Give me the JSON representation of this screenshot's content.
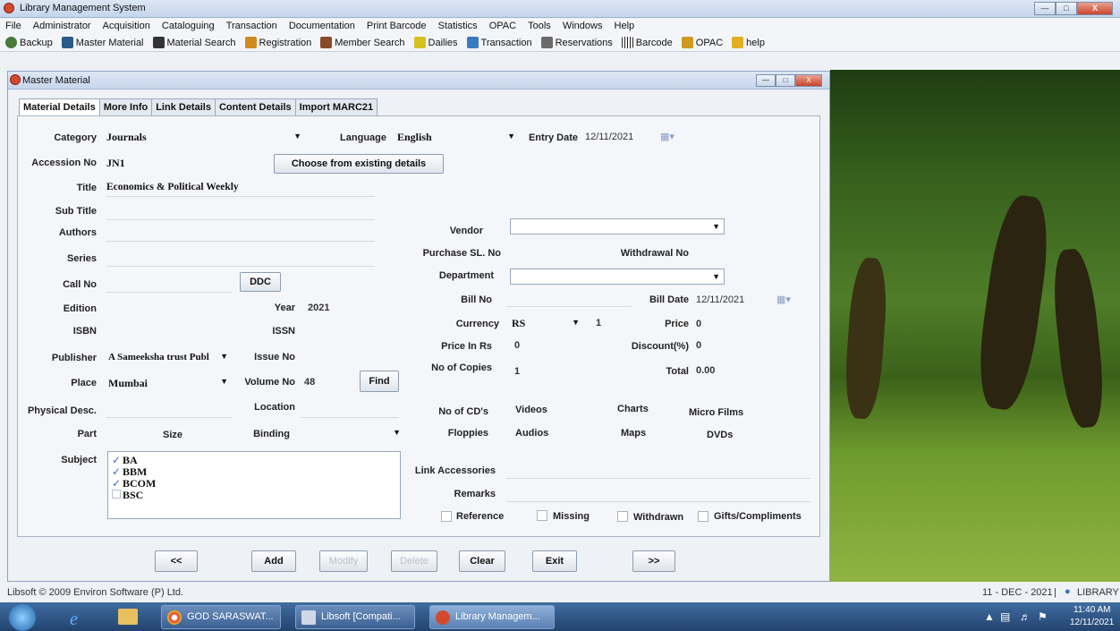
{
  "app": {
    "title": "Library Management System"
  },
  "menu": [
    "File",
    "Administrator",
    "Acquisition",
    "Cataloguing",
    "Transaction",
    "Documentation",
    "Print Barcode",
    "Statistics",
    "OPAC",
    "Tools",
    "Windows",
    "Help"
  ],
  "toolbar": [
    {
      "label": "Backup",
      "icon": "backup-icon",
      "color": "#4a7a3a"
    },
    {
      "label": "Master Material",
      "icon": "books-icon",
      "color": "#2a5a8a"
    },
    {
      "label": "Material Search",
      "icon": "binoculars-icon",
      "color": "#333"
    },
    {
      "label": "Registration",
      "icon": "registration-icon",
      "color": "#d08a20"
    },
    {
      "label": "Member Search",
      "icon": "members-icon",
      "color": "#8a4a2a"
    },
    {
      "label": "Dailies",
      "icon": "dailies-icon",
      "color": "#d8c020"
    },
    {
      "label": "Transaction",
      "icon": "transaction-icon",
      "color": "#3a7ac0"
    },
    {
      "label": "Reservations",
      "icon": "reservations-icon",
      "color": "#6a6a6a"
    },
    {
      "label": "Barcode",
      "icon": "barcode-icon",
      "color": "#222"
    },
    {
      "label": "OPAC",
      "icon": "opac-icon",
      "color": "#d09a20"
    },
    {
      "label": "help",
      "icon": "help-icon",
      "color": "#e0b020"
    }
  ],
  "window": {
    "title": "Master Material"
  },
  "tabs": [
    "Material Details",
    "More Info",
    "Link Details",
    "Content Details",
    "Import MARC21"
  ],
  "form": {
    "category_label": "Category",
    "category": "Journals",
    "language_label": "Language",
    "language": "English",
    "entry_date_label": "Entry Date",
    "entry_date": "12/11/2021",
    "accession_label": "Accession No",
    "accession": "JN1",
    "choose_btn": "Choose from existing details",
    "title_label": "Title",
    "title": "Economics & Political Weekly",
    "subtitle_label": "Sub Title",
    "authors_label": "Authors",
    "series_label": "Series",
    "callno_label": "Call No",
    "ddc_btn": "DDC",
    "edition_label": "Edition",
    "year_label": "Year",
    "year": "2021",
    "isbn_label": "ISBN",
    "issn_label": "ISSN",
    "publisher_label": "Publisher",
    "publisher": "A Sameeksha trust Publ",
    "issueno_label": "Issue No",
    "place_label": "Place",
    "place": "Mumbai",
    "volume_label": "Volume No",
    "volume": "48",
    "find_btn": "Find",
    "physical_label": "Physical Desc.",
    "location_label": "Location",
    "part_label": "Part",
    "size_label": "Size",
    "binding_label": "Binding",
    "subject_label": "Subject",
    "subjects": [
      {
        "name": "BA",
        "checked": true
      },
      {
        "name": "BBM",
        "checked": true
      },
      {
        "name": "BCOM",
        "checked": true
      },
      {
        "name": "BSC",
        "checked": false
      }
    ],
    "vendor_label": "Vendor",
    "purchase_label": "Purchase SL. No",
    "withdrawal_label": "Withdrawal No",
    "department_label": "Department",
    "billno_label": "Bill No",
    "billdate_label": "Bill Date",
    "billdate": "12/11/2021",
    "currency_label": "Currency",
    "currency": "RS",
    "currency_rate": "1",
    "price_label": "Price",
    "price": "0",
    "priceinrs_label": "Price In Rs",
    "priceinrs": "0",
    "discount_label": "Discount(%)",
    "discount": "0",
    "copies_label": "No of Copies",
    "copies": "1",
    "total_label": "Total",
    "total": "0.00",
    "cds_label": "No of CD's",
    "videos_label": "Videos",
    "charts_label": "Charts",
    "microfilms_label": "Micro Films",
    "floppies_label": "Floppies",
    "audios_label": "Audios",
    "maps_label": "Maps",
    "dvds_label": "DVDs",
    "linkacc_label": "Link Accessories",
    "remarks_label": "Remarks",
    "reference_label": "Reference",
    "missing_label": "Missing",
    "withdrawn_label": "Withdrawn",
    "gifts_label": "Gifts/Compliments"
  },
  "buttons": {
    "prev": "<<",
    "add": "Add",
    "modify": "Modify",
    "delete": "Delete",
    "clear": "Clear",
    "exit": "Exit",
    "next": ">>"
  },
  "status": {
    "left": "Libsoft © 2009 Environ Software (P) Ltd.",
    "right": "11 - DEC - 2021",
    "user": "LIBRARY"
  },
  "taskbar": {
    "items": [
      "GOD SARASWAT...",
      "Libsoft [Compati...",
      "Library Managem..."
    ],
    "time": "11:40 AM",
    "date": "12/11/2021"
  }
}
